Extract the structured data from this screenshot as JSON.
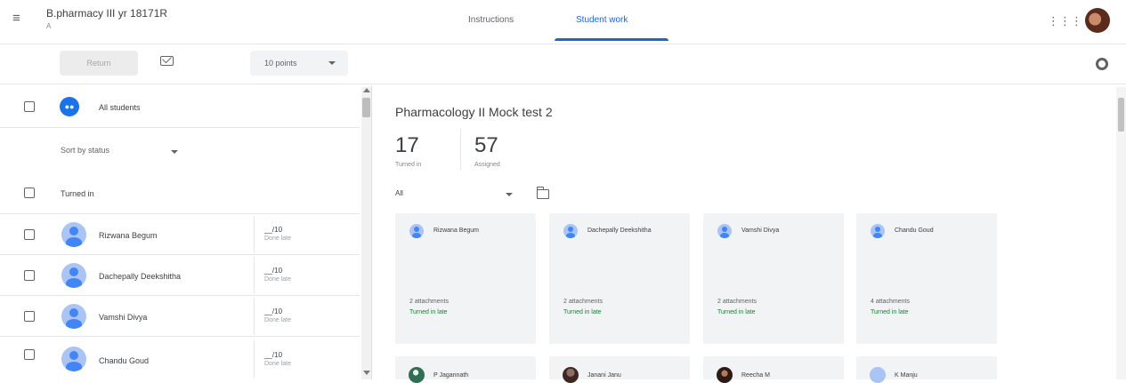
{
  "header": {
    "class_name": "B.pharmacy III yr 18171R",
    "class_section": "A",
    "tabs": [
      "Instructions",
      "Student work"
    ],
    "active_tab": "Student work",
    "icons": [
      "menu-icon",
      "apps-grid-icon",
      "user-avatar"
    ]
  },
  "toolbar": {
    "return_label": "Return",
    "points_value": "10 points",
    "icons": [
      "email-icon",
      "settings-gear-icon"
    ]
  },
  "left_panel": {
    "all_students": "All students",
    "sort_label": "Sort by status",
    "section_label": "Turned in",
    "students": [
      {
        "name": "Rizwana Begum",
        "grade": "__/10",
        "status": "Done late"
      },
      {
        "name": "Dachepally Deekshitha",
        "grade": "__/10",
        "status": "Done late"
      },
      {
        "name": "Vamshi Divya",
        "grade": "__/10",
        "status": "Done late"
      },
      {
        "name": "Chandu Goud",
        "grade": "__/10",
        "status": "Done late"
      }
    ]
  },
  "right_panel": {
    "assignment_title": "Pharmacology II Mock test 2",
    "turned_in_count": "17",
    "turned_in_label": "Turned in",
    "assigned_count": "57",
    "assigned_label": "Assigned",
    "filter_value": "All",
    "cards": [
      {
        "name": "Rizwana Begum",
        "attachments": "2 attachments",
        "status": "Turned in late"
      },
      {
        "name": "Dachepally Deekshitha",
        "attachments": "2 attachments",
        "status": "Turned in late"
      },
      {
        "name": "Vamshi Divya",
        "attachments": "2 attachments",
        "status": "Turned in late"
      },
      {
        "name": "Chandu Goud",
        "attachments": "4 attachments",
        "status": "Turned in late"
      }
    ],
    "bottom_cards": [
      {
        "name": "P Jagannath"
      },
      {
        "name": "Janani Janu"
      },
      {
        "name": "Reecha M"
      },
      {
        "name": "K Manju"
      }
    ]
  },
  "colors": {
    "accent": "#1967d2",
    "status_green": "#188038",
    "card_bg": "#f1f3f4"
  }
}
